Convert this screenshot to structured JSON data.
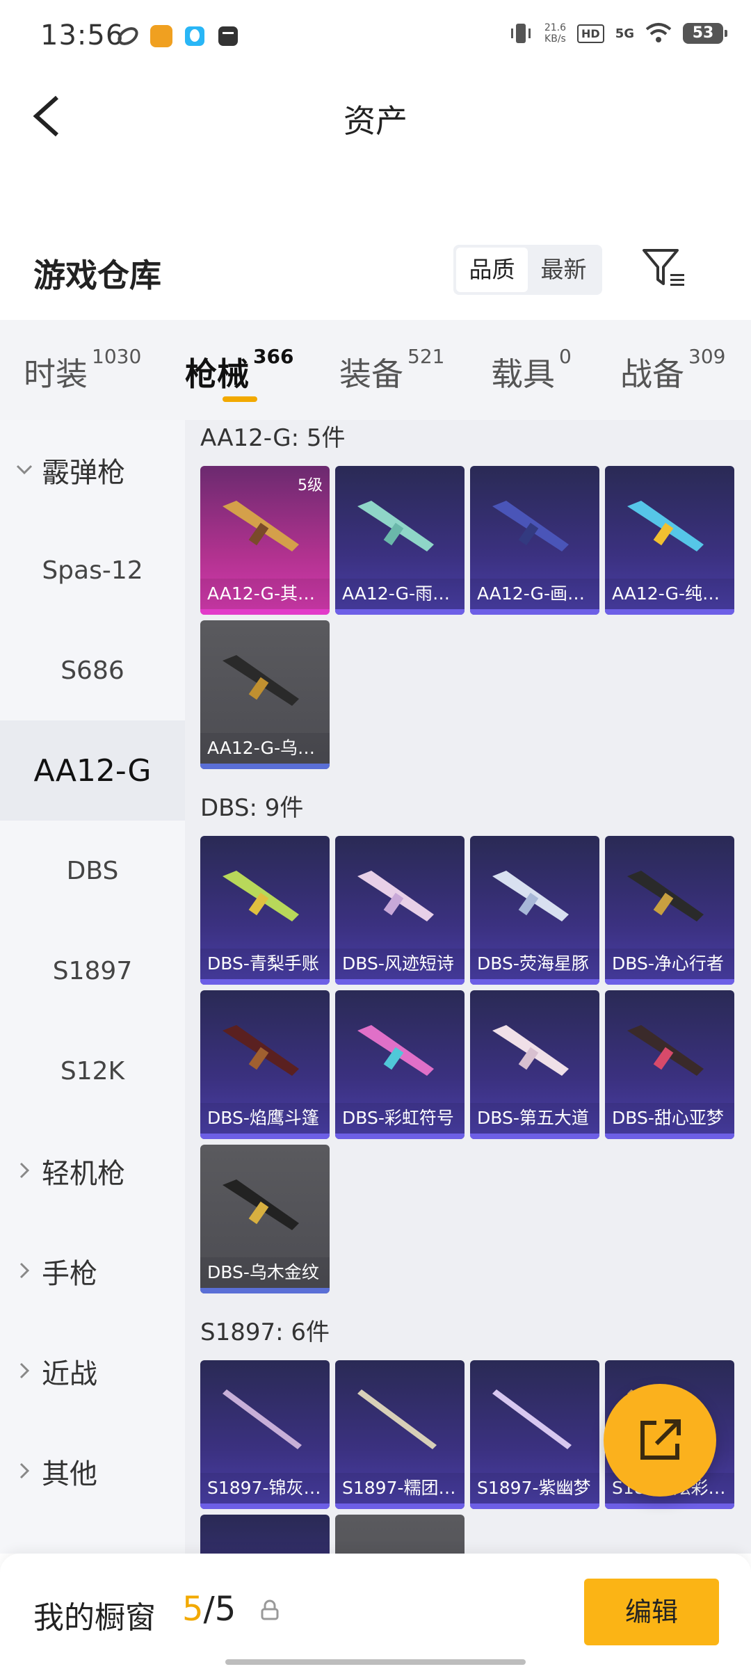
{
  "status_bar": {
    "time": "13:56",
    "net_speed_value": "21.6",
    "net_speed_unit": "KB/s",
    "hd": "HD",
    "signal": "5G",
    "battery": "53"
  },
  "header": {
    "title": "资产"
  },
  "warehouse": {
    "title": "游戏仓库",
    "sort_quality": "品质",
    "sort_newest": "最新"
  },
  "tabs": [
    {
      "label": "时装",
      "count": "1030"
    },
    {
      "label": "枪械",
      "count": "366"
    },
    {
      "label": "装备",
      "count": "521"
    },
    {
      "label": "载具",
      "count": "0"
    },
    {
      "label": "战备",
      "count": "309"
    }
  ],
  "sidebar": {
    "group_shotgun": "霰弹枪",
    "items": [
      "Spas-12",
      "S686",
      "AA12-G",
      "DBS",
      "S1897",
      "S12K"
    ],
    "group_lmg": "轻机枪",
    "group_pistol": "手枪",
    "group_melee": "近战",
    "group_other": "其他"
  },
  "sections": [
    {
      "title": "AA12-G: 5件",
      "items": [
        {
          "label": "AA12-G-其…",
          "badge": "5级"
        },
        {
          "label": "AA12-G-雨…"
        },
        {
          "label": "AA12-G-画…"
        },
        {
          "label": "AA12-G-纯…"
        },
        {
          "label": "AA12-G-乌…"
        }
      ]
    },
    {
      "title": "DBS: 9件",
      "items": [
        {
          "label": "DBS-青梨手账"
        },
        {
          "label": "DBS-风迹短诗"
        },
        {
          "label": "DBS-荧海星豚"
        },
        {
          "label": "DBS-净心行者"
        },
        {
          "label": "DBS-焰鹰斗篷"
        },
        {
          "label": "DBS-彩虹符号"
        },
        {
          "label": "DBS-第五大道"
        },
        {
          "label": "DBS-甜心亚梦"
        },
        {
          "label": "DBS-乌木金纹"
        }
      ]
    },
    {
      "title": "S1897: 6件",
      "items": [
        {
          "label": "S1897-锦灰…"
        },
        {
          "label": "S1897-糯团…"
        },
        {
          "label": "S1897-紫幽梦"
        },
        {
          "label": "S1897-炫彩…"
        }
      ]
    }
  ],
  "bottom_bar": {
    "label": "我的橱窗",
    "current": "5",
    "separator": "/",
    "total": "5",
    "edit": "编辑"
  },
  "colors": {
    "accent": "#f2a900",
    "button": "#fbb415"
  }
}
